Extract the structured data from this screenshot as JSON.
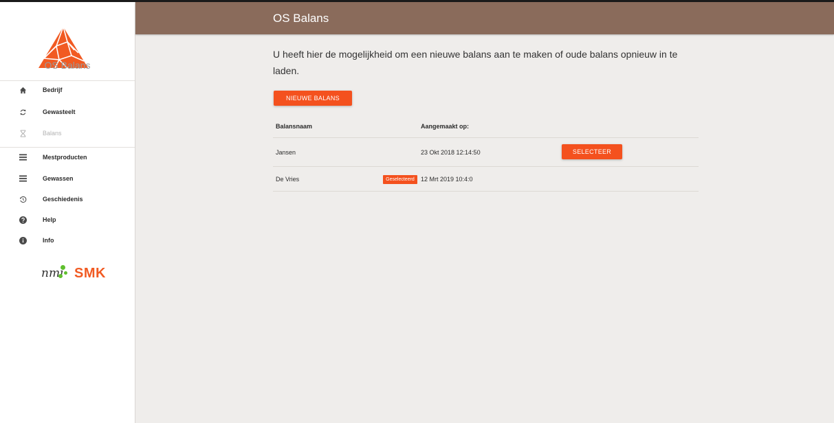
{
  "app": {
    "logo_text": "OS Balans",
    "header_title": "OS Balans"
  },
  "sidebar": {
    "items": [
      {
        "label": "Bedrijf",
        "icon": "home-icon",
        "enabled": true
      },
      {
        "label": "Gewasteelt",
        "icon": "sync-icon",
        "enabled": true
      },
      {
        "label": "Balans",
        "icon": "hourglass-icon",
        "enabled": false
      },
      {
        "label": "Mestproducten",
        "icon": "list-icon",
        "enabled": true
      },
      {
        "label": "Gewassen",
        "icon": "list-icon",
        "enabled": true
      },
      {
        "label": "Geschiedenis",
        "icon": "history-icon",
        "enabled": true
      },
      {
        "label": "Help",
        "icon": "help-icon",
        "enabled": true
      },
      {
        "label": "Info",
        "icon": "info-icon",
        "enabled": true
      }
    ],
    "partners": {
      "nmi": "nmi",
      "smk": "SMK"
    }
  },
  "main": {
    "intro": "U heeft hier de mogelijkheid om een nieuwe balans aan te maken of oude balans opnieuw in te laden.",
    "new_button": "NIEUWE BALANS",
    "table": {
      "headers": {
        "name": "Balansnaam",
        "created": "Aangemaakt op:"
      },
      "rows": [
        {
          "name": "Jansen",
          "created": "23 Okt 2018 12:14:50",
          "badge": "",
          "action": "SELECTEER"
        },
        {
          "name": "De Vries",
          "created": "12 Mrt 2019 10:4:0",
          "badge": "Geselecteerd",
          "action": ""
        }
      ]
    }
  },
  "colors": {
    "header": "#8a6b5b",
    "accent": "#f4511e",
    "background": "#efedeb"
  }
}
